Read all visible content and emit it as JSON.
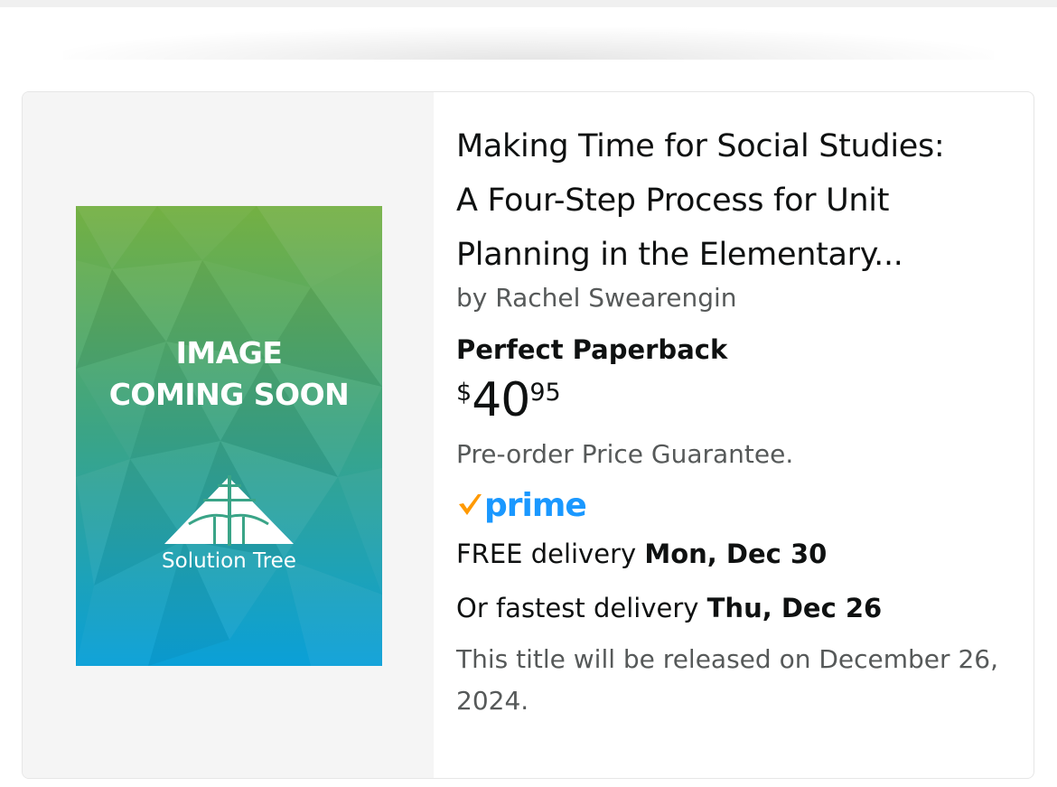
{
  "cover": {
    "placeholder_line1": "IMAGE",
    "placeholder_line2": "COMING SOON",
    "publisher": "Solution Tree"
  },
  "product": {
    "title_line1": "Making Time for Social Studies:",
    "title_line2": "A Four-Step Process for Unit",
    "title_line3": "Planning in the Elementary...",
    "author": "by Rachel Swearengin",
    "format": "Perfect Paperback",
    "price_symbol": "$",
    "price_whole": "40",
    "price_fraction": "95",
    "price_note": "Pre-order Price Guarantee.",
    "prime_label": "prime",
    "delivery_prefix": "FREE delivery ",
    "delivery_date": "Mon, Dec 30",
    "fastest_prefix": "Or fastest delivery ",
    "fastest_date": "Thu, Dec 26",
    "release_note": "This title will be released on December 26, 2024."
  },
  "colors": {
    "prime_blue": "#1a98ff",
    "prime_check": "#ff9900",
    "muted_text": "#565959",
    "cover_top": "#74b042",
    "cover_bottom": "#0aa0d8"
  },
  "icons": [
    "prime-check-icon",
    "solution-tree-logo-icon"
  ]
}
